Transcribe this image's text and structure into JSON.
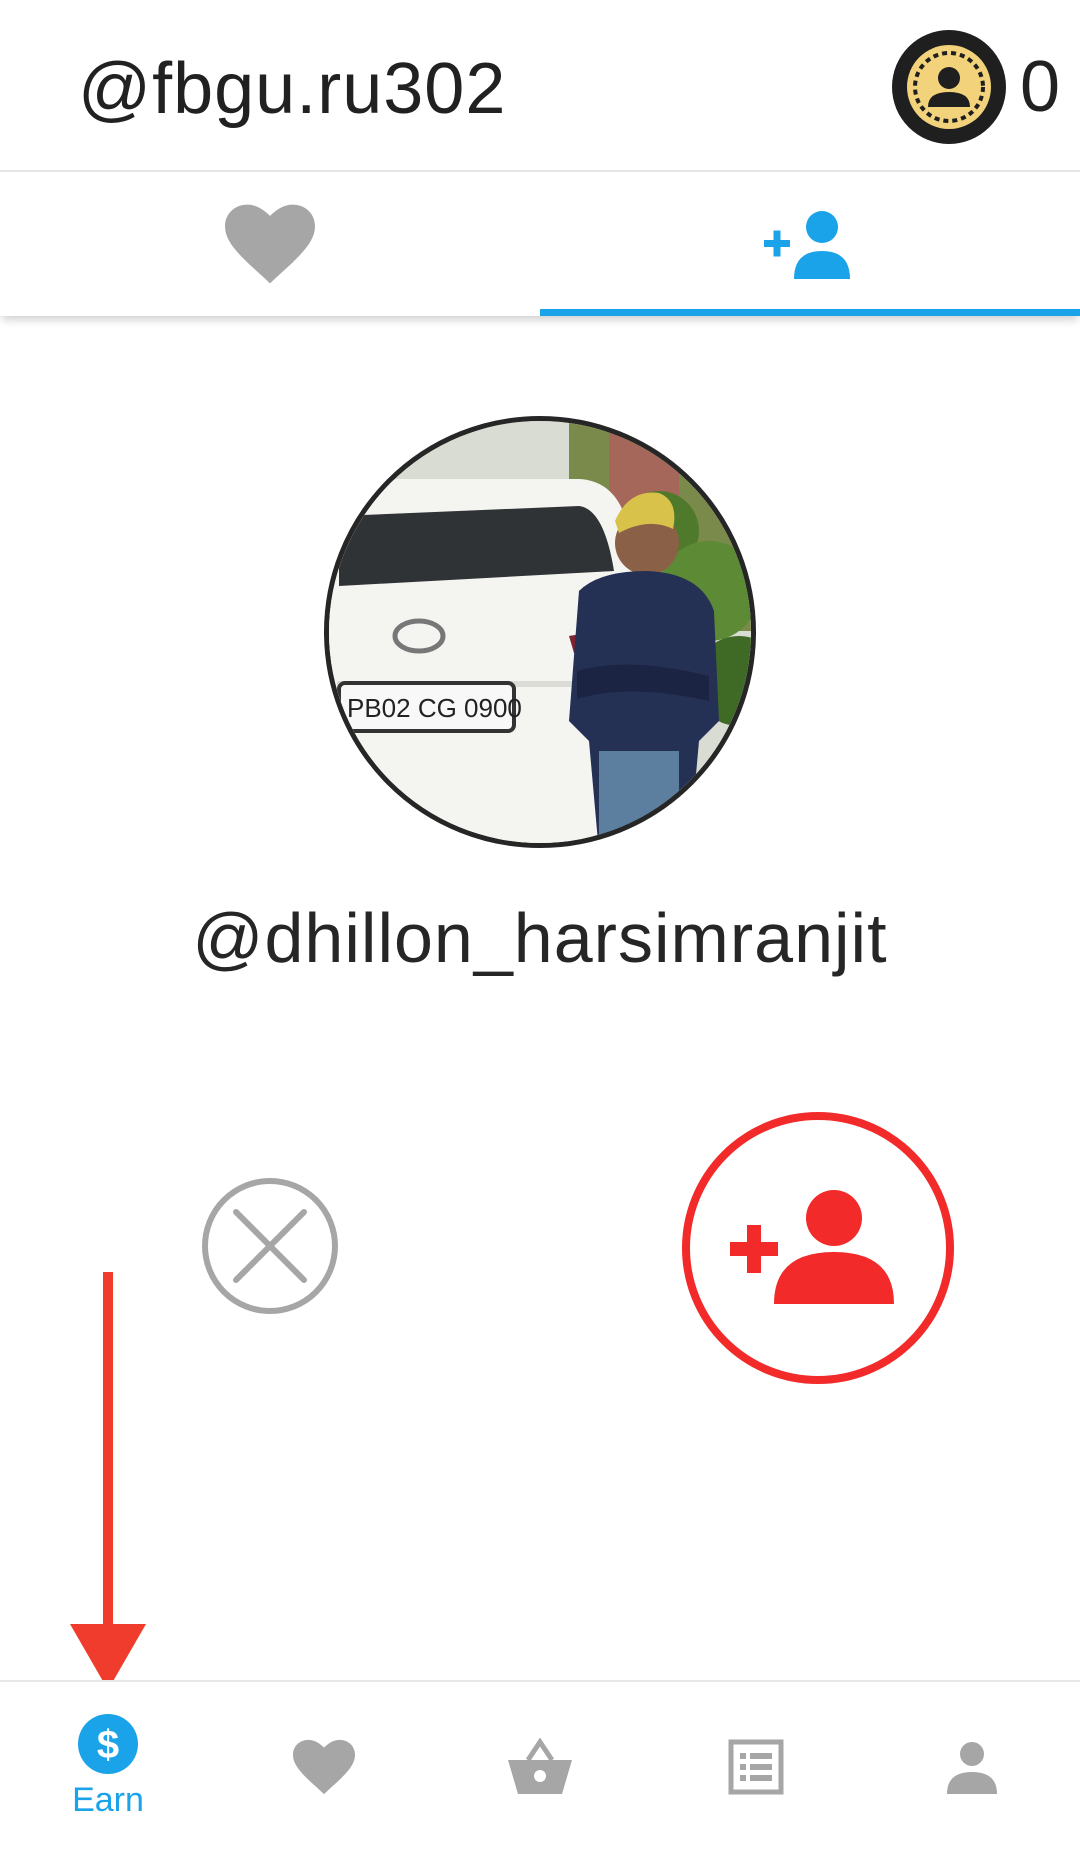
{
  "header": {
    "username": "@fbgu.ru302",
    "coin_icon": "coin-user-icon",
    "coin_count": "0"
  },
  "tabs": [
    {
      "icon": "heart-icon",
      "active": false
    },
    {
      "icon": "add-person-icon",
      "active": true
    }
  ],
  "profile": {
    "name": "@dhillon_harsimranjit",
    "plate_text": "PB02 CG 0900"
  },
  "actions": {
    "skip_icon": "close-circle-icon",
    "follow_icon": "add-person-icon"
  },
  "bottom_nav": [
    {
      "icon": "dollar-icon",
      "label": "Earn",
      "active": true
    },
    {
      "icon": "heart-icon",
      "label": "",
      "active": false
    },
    {
      "icon": "basket-icon",
      "label": "",
      "active": false
    },
    {
      "icon": "list-icon",
      "label": "",
      "active": false
    },
    {
      "icon": "person-icon",
      "label": "",
      "active": false
    }
  ],
  "colors": {
    "accent": "#1aa3e8",
    "follow": "#f22a2a",
    "annotation": "#f03c2c",
    "inactive_icon": "#a6a6a6",
    "coin": "#f2d27a"
  }
}
